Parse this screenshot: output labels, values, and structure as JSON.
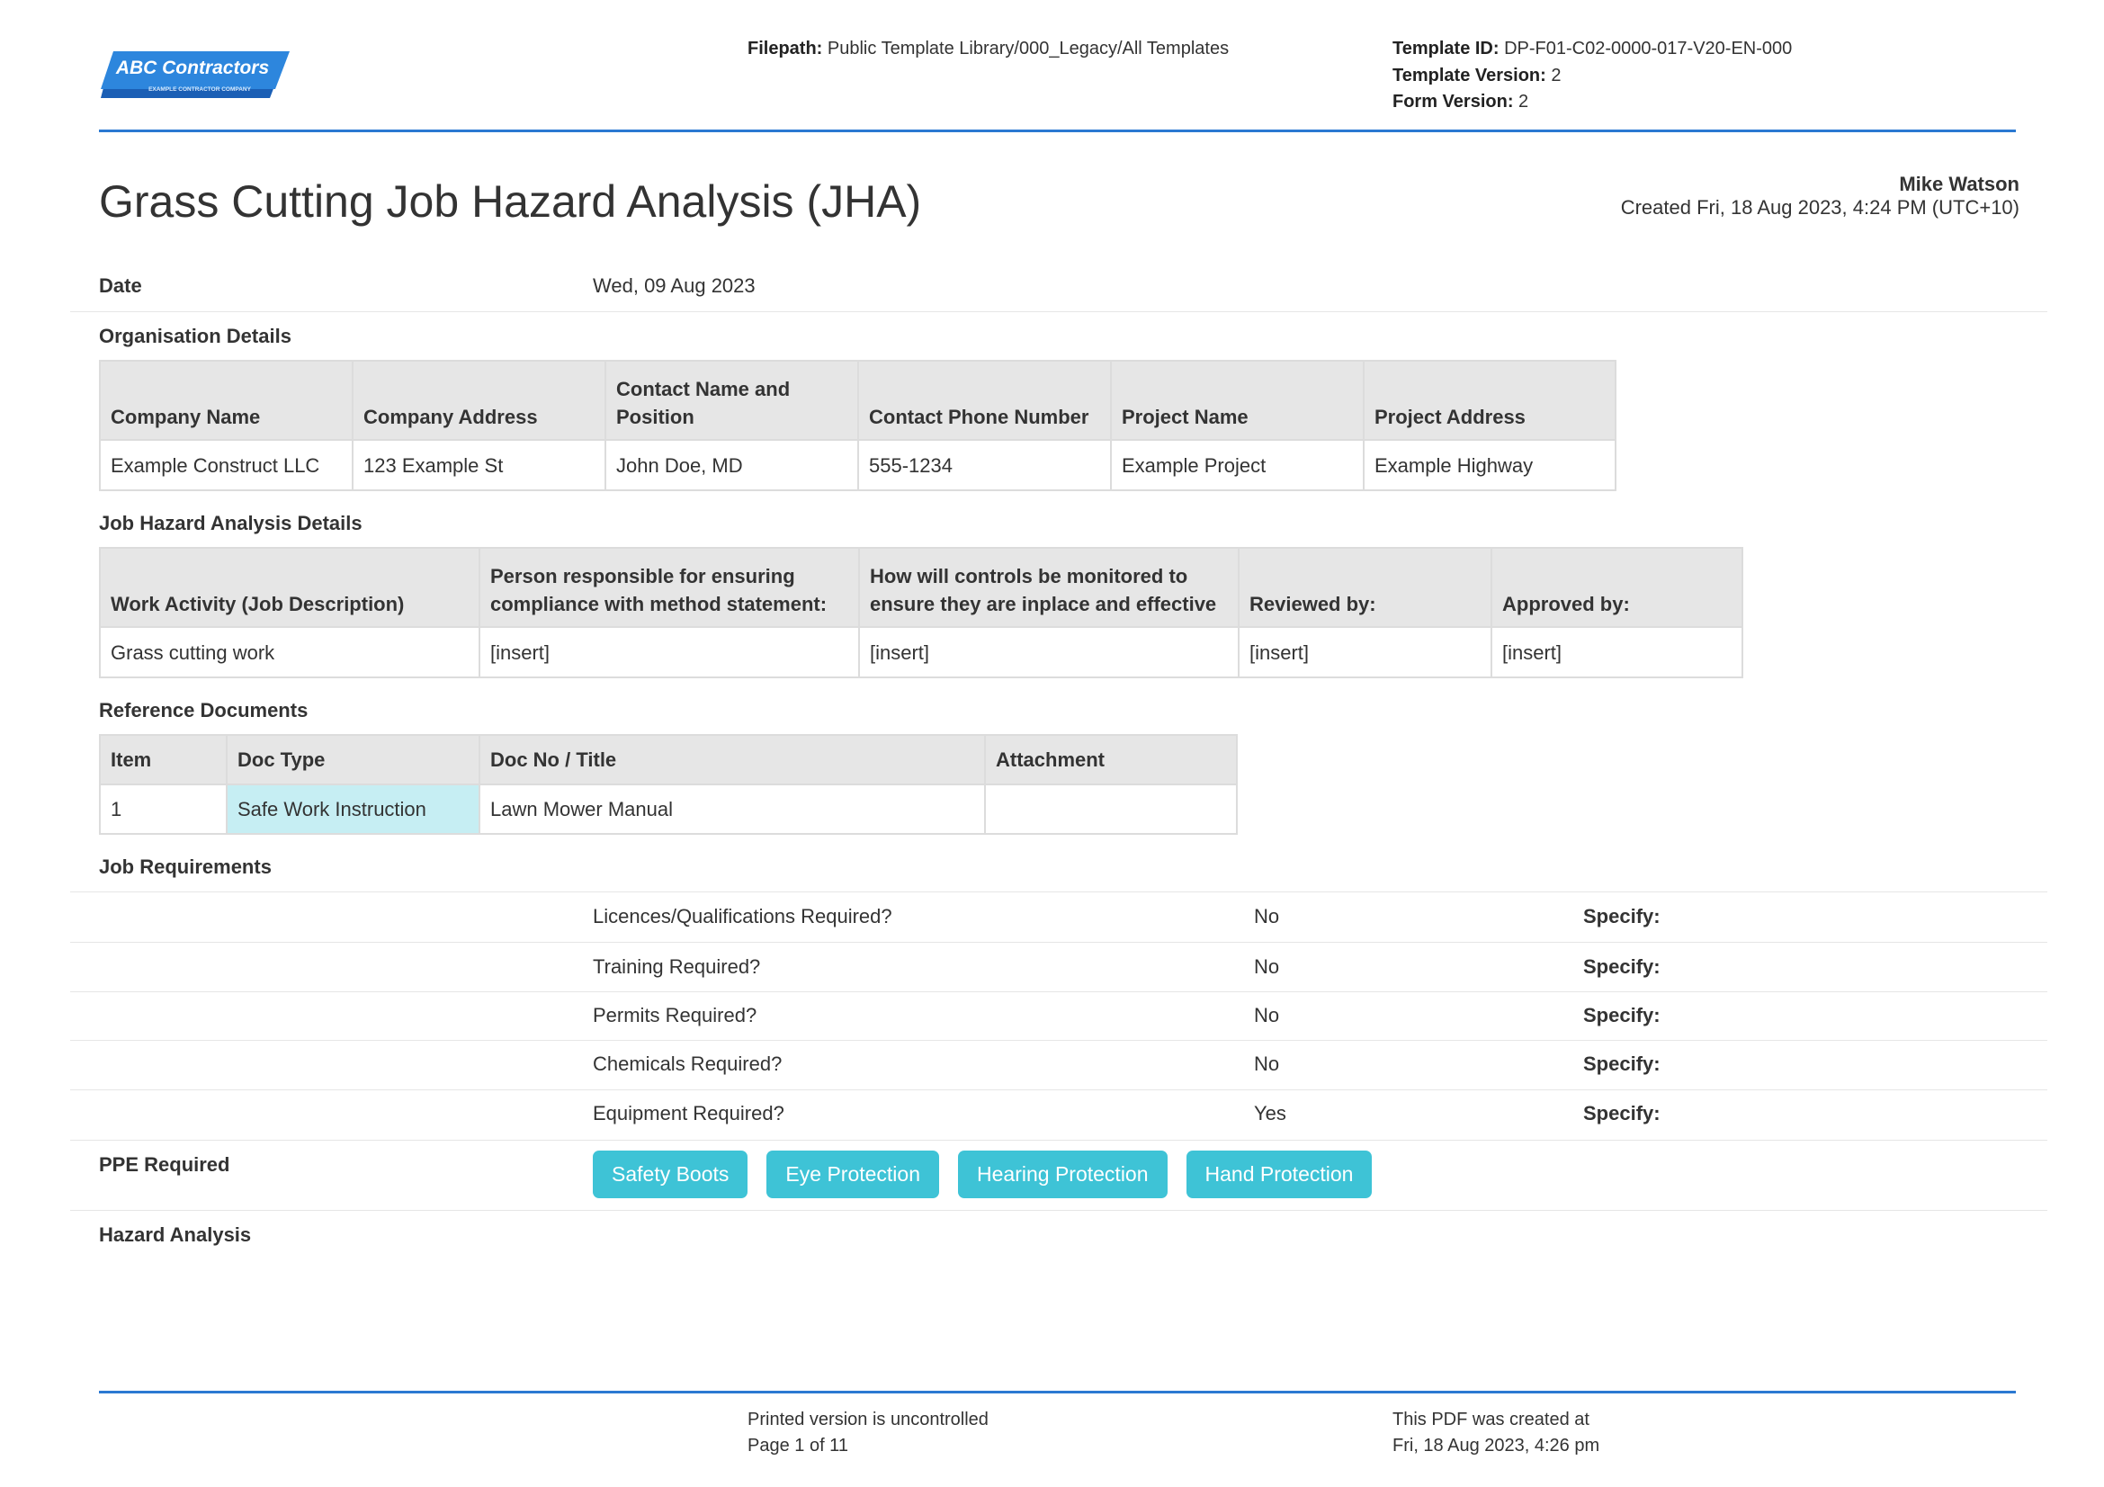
{
  "logo": {
    "name": "ABC Contractors",
    "tagline": "EXAMPLE CONTRACTOR COMPANY"
  },
  "header": {
    "filepath_label": "Filepath:",
    "filepath_value": "Public Template Library/000_Legacy/All Templates",
    "template_id_label": "Template ID:",
    "template_id_value": "DP-F01-C02-0000-017-V20-EN-000",
    "template_version_label": "Template Version:",
    "template_version_value": "2",
    "form_version_label": "Form Version:",
    "form_version_value": "2"
  },
  "document": {
    "title": "Grass Cutting Job Hazard Analysis (JHA)",
    "author": "Mike Watson",
    "created": "Created Fri, 18 Aug 2023, 4:24 PM (UTC+10)"
  },
  "date_field": {
    "label": "Date",
    "value": "Wed, 09 Aug 2023"
  },
  "organisation": {
    "heading": "Organisation Details",
    "columns": [
      "Company Name",
      "Company Address",
      "Contact Name and Position",
      "Contact Phone Number",
      "Project Name",
      "Project Address"
    ],
    "row": [
      "Example Construct LLC",
      "123 Example St",
      "John Doe, MD",
      "555-1234",
      "Example Project",
      "Example Highway"
    ]
  },
  "jha_details": {
    "heading": "Job Hazard Analysis Details",
    "columns": [
      "Work Activity (Job Description)",
      "Person responsible for ensuring compliance with method statement:",
      "How will controls be monitored to ensure they are inplace and effective",
      "Reviewed by:",
      "Approved by:"
    ],
    "row": [
      "Grass cutting work",
      "[insert]",
      "[insert]",
      "[insert]",
      "[insert]"
    ]
  },
  "reference_docs": {
    "heading": "Reference Documents",
    "columns": [
      "Item",
      "Doc Type",
      "Doc No / Title",
      "Attachment"
    ],
    "row": [
      "1",
      "Safe Work Instruction",
      "Lawn Mower Manual",
      ""
    ]
  },
  "job_requirements": {
    "heading": "Job Requirements",
    "specify_label": "Specify:",
    "items": [
      {
        "question": "Licences/Qualifications Required?",
        "answer": "No"
      },
      {
        "question": "Training Required?",
        "answer": "No"
      },
      {
        "question": "Permits Required?",
        "answer": "No"
      },
      {
        "question": "Chemicals Required?",
        "answer": "No"
      },
      {
        "question": "Equipment Required?",
        "answer": "Yes"
      }
    ]
  },
  "ppe": {
    "label": "PPE Required",
    "items": [
      "Safety Boots",
      "Eye Protection",
      "Hearing Protection",
      "Hand Protection"
    ]
  },
  "hazard_analysis": {
    "heading": "Hazard Analysis"
  },
  "footer": {
    "line1": "Printed version is uncontrolled",
    "line2": "Page 1 of 11",
    "created_line1": "This PDF was created at",
    "created_line2": "Fri, 18 Aug 2023, 4:26 pm"
  },
  "colors": {
    "accent": "#2b79d2",
    "chip": "#3ec3d6",
    "highlight": "#c6eef3",
    "header_fill": "#e6e6e6"
  }
}
